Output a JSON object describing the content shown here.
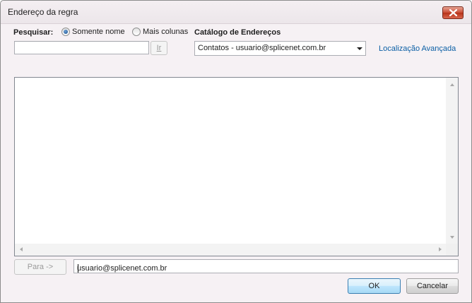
{
  "window": {
    "title": "Endereço da regra"
  },
  "search": {
    "label": "Pesquisar:",
    "option_name_only": "Somente nome",
    "option_more_columns": "Mais colunas",
    "selected": "Somente nome",
    "input_value": "",
    "go_label": "Ir"
  },
  "address_book": {
    "label": "Catálogo de Endereços",
    "selected": "Contatos - usuario@splicenet.com.br",
    "advanced_link": "Localização Avançada"
  },
  "results_list": {
    "items": []
  },
  "footer": {
    "to_button": "Para ->",
    "to_value": "usuario@splicenet.com.br",
    "ok_label": "OK",
    "cancel_label": "Cancelar"
  },
  "colors": {
    "link": "#0b5fa5",
    "close_button": "#c94a33",
    "default_button_border": "#3c7fb1"
  }
}
